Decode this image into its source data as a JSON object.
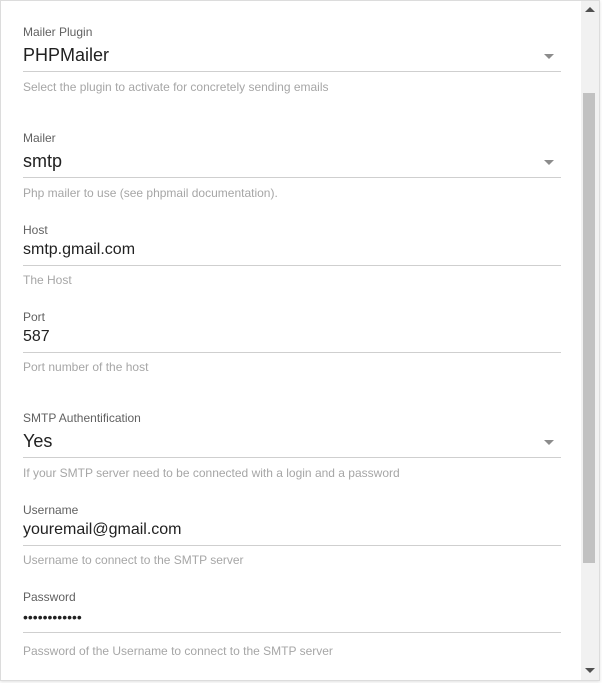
{
  "fields": [
    {
      "label": "Mailer Plugin",
      "value": "PHPMailer",
      "hint": "Select the plugin to activate for concretely sending emails",
      "type": "select"
    },
    {
      "label": "Mailer",
      "value": "smtp",
      "hint": "Php mailer to use (see phpmail documentation).",
      "type": "select"
    },
    {
      "label": "Host",
      "value": "smtp.gmail.com",
      "hint": "The Host",
      "type": "text"
    },
    {
      "label": "Port",
      "value": "587",
      "hint": "Port number of the host",
      "type": "text"
    },
    {
      "label": "SMTP Authentification",
      "value": "Yes",
      "hint": "If your SMTP server need to be connected with a login and a password",
      "type": "select"
    },
    {
      "label": "Username",
      "value": "youremail@gmail.com",
      "hint": "Username to connect to the SMTP server",
      "type": "text"
    },
    {
      "label": "Password",
      "value": "••••••••••••",
      "hint": "Password of the Username to connect to the SMTP server",
      "type": "password"
    }
  ],
  "icons": {
    "select_caret": "chevron-down-icon",
    "scroll_up": "scroll-up-arrow-icon",
    "scroll_down": "scroll-down-arrow-icon"
  }
}
